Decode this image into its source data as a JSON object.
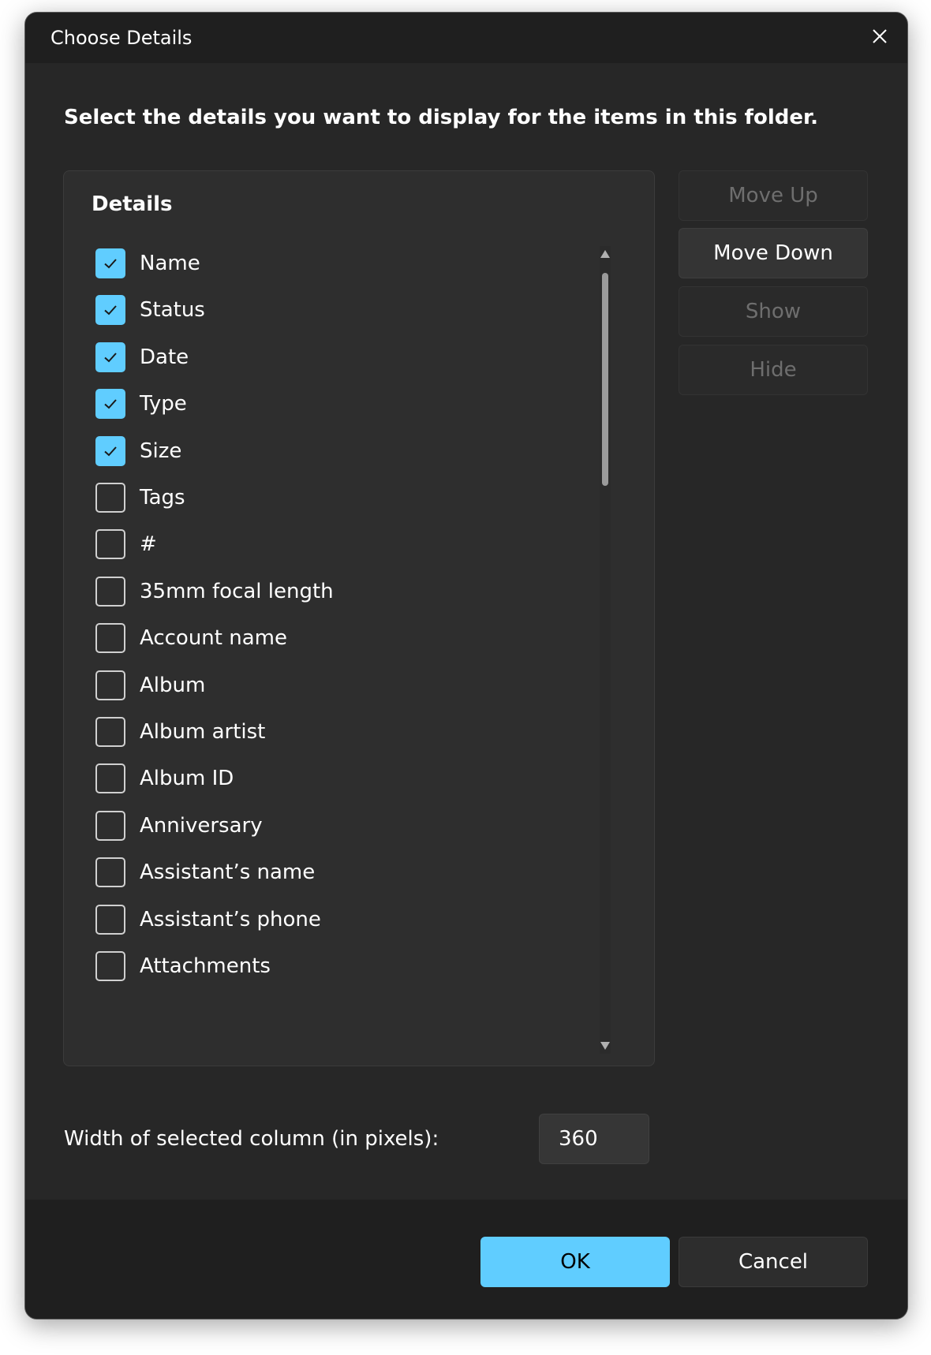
{
  "window": {
    "title": "Choose Details",
    "close_icon": "close-icon"
  },
  "instruction": "Select the details you want to display for the items in this folder.",
  "details": {
    "heading": "Details",
    "items": [
      {
        "label": "Name",
        "checked": true
      },
      {
        "label": "Status",
        "checked": true
      },
      {
        "label": "Date",
        "checked": true
      },
      {
        "label": "Type",
        "checked": true
      },
      {
        "label": "Size",
        "checked": true
      },
      {
        "label": "Tags",
        "checked": false
      },
      {
        "label": "#",
        "checked": false
      },
      {
        "label": "35mm focal length",
        "checked": false
      },
      {
        "label": "Account name",
        "checked": false
      },
      {
        "label": "Album",
        "checked": false
      },
      {
        "label": "Album artist",
        "checked": false
      },
      {
        "label": "Album ID",
        "checked": false
      },
      {
        "label": "Anniversary",
        "checked": false
      },
      {
        "label": "Assistant’s name",
        "checked": false
      },
      {
        "label": "Assistant’s phone",
        "checked": false
      },
      {
        "label": "Attachments",
        "checked": false
      }
    ]
  },
  "side_buttons": {
    "move_up": {
      "label": "Move Up",
      "enabled": false
    },
    "move_down": {
      "label": "Move Down",
      "enabled": true
    },
    "show": {
      "label": "Show",
      "enabled": false
    },
    "hide": {
      "label": "Hide",
      "enabled": false
    }
  },
  "column_width": {
    "label": "Width of selected column (in pixels):",
    "value": "360"
  },
  "footer": {
    "ok_label": "OK",
    "cancel_label": "Cancel"
  },
  "colors": {
    "accent": "#60cdff",
    "dialog_background": "#272727",
    "titlebar_background": "#1f1f1f"
  }
}
